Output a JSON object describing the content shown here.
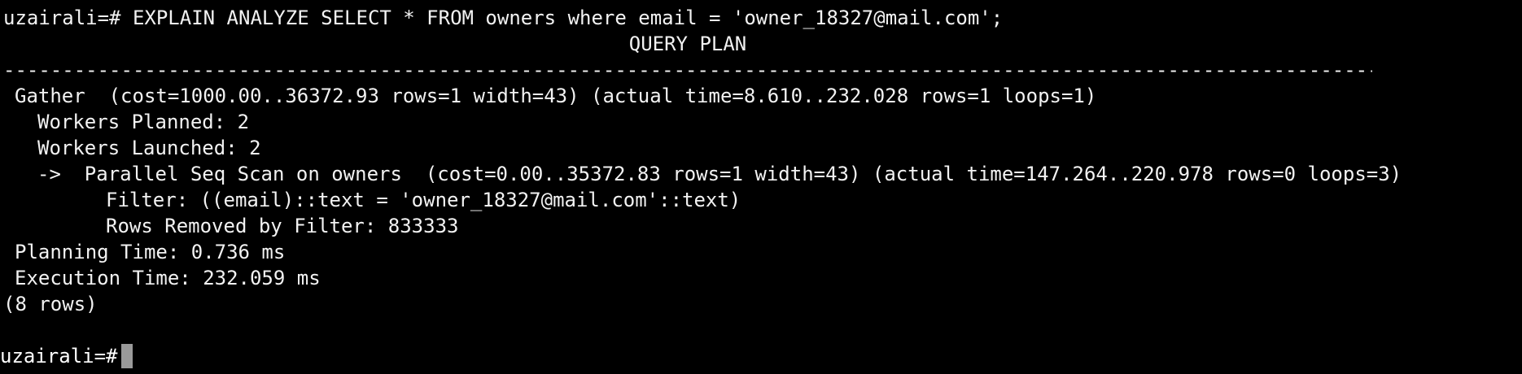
{
  "terminal": {
    "prompt": "uzairali=#",
    "command": "EXPLAIN ANALYZE SELECT * FROM owners where email = 'owner_18327@mail.com';",
    "column_header": "QUERY PLAN",
    "separator": "-------------------------------------------------------------------------------------------------------------------------------------------------------------------------------------",
    "plan": {
      "gather": "Gather  (cost=1000.00..36372.93 rows=1 width=43) (actual time=8.610..232.028 rows=1 loops=1)",
      "workers_planned": "Workers Planned: 2",
      "workers_launched": "Workers Launched: 2",
      "seq_scan": "->  Parallel Seq Scan on owners  (cost=0.00..35372.83 rows=1 width=43) (actual time=147.264..220.978 rows=0 loops=3)",
      "filter": "Filter: ((email)::text = 'owner_18327@mail.com'::text)",
      "rows_removed": "Rows Removed by Filter: 833333",
      "planning_time": "Planning Time: 0.736 ms",
      "execution_time": "Execution Time: 232.059 ms"
    },
    "row_count": "(8 rows)",
    "final_prompt": "uzairali=#",
    "colors": {
      "background": "#000000",
      "text": "#f2f2f2",
      "cursor": "#9a9a9a"
    }
  }
}
